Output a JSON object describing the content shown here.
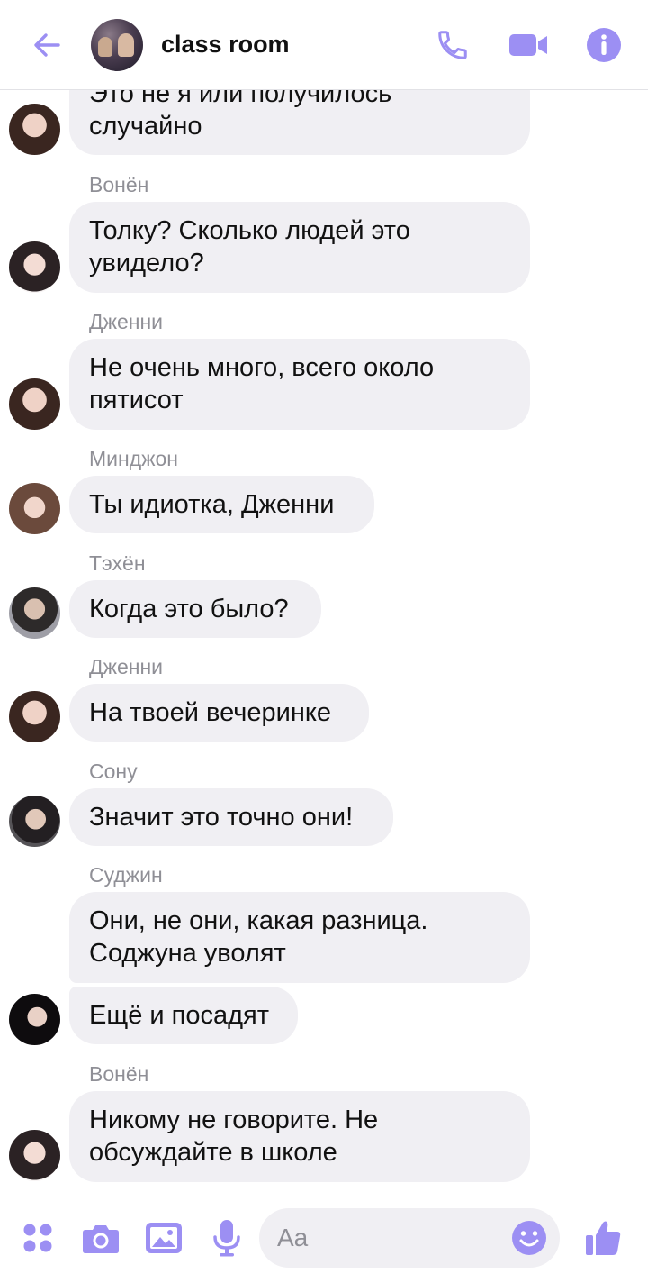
{
  "header": {
    "title": "class room"
  },
  "colors": {
    "accent": "#9c8ff3",
    "bubble": "#f0eff3",
    "sender_text": "#8f8f96"
  },
  "messages": [
    {
      "sender": "",
      "text": "Это не я или получилось случайно",
      "avatar": "jennie"
    },
    {
      "sender": "Вонён",
      "text": "Толку? Сколько людей это увидело?",
      "avatar": "wonyoung"
    },
    {
      "sender": "Дженни",
      "text": "Не очень много, всего около пятисот",
      "avatar": "jennie"
    },
    {
      "sender": "Минджон",
      "text": "Ты идиотка, Дженни",
      "avatar": "minjeong"
    },
    {
      "sender": "Тэхён",
      "text": "Когда это было?",
      "avatar": "taehyun"
    },
    {
      "sender": "Дженни",
      "text": "На твоей вечеринке",
      "avatar": "jennie"
    },
    {
      "sender": "Сону",
      "text": "Значит это точно они!",
      "avatar": "sonu"
    },
    {
      "sender": "Суджин",
      "text": "Они, не они, какая разница. Соджуна уволят",
      "avatar": ""
    },
    {
      "sender": "",
      "text": "Ещё и посадят",
      "avatar": "sujin"
    },
    {
      "sender": "Вонён",
      "text": "Никому не говорите. Не обсуждайте в школе",
      "avatar": "wonyoung"
    }
  ],
  "composer": {
    "placeholder": "Aa"
  },
  "icons": {
    "back": "arrow-left-icon",
    "call": "phone-icon",
    "video": "video-camera-icon",
    "info": "info-icon",
    "apps": "four-dots-icon",
    "camera": "camera-icon",
    "gallery": "image-icon",
    "mic": "microphone-icon",
    "emoji": "smiley-icon",
    "like": "thumbs-up-icon"
  }
}
